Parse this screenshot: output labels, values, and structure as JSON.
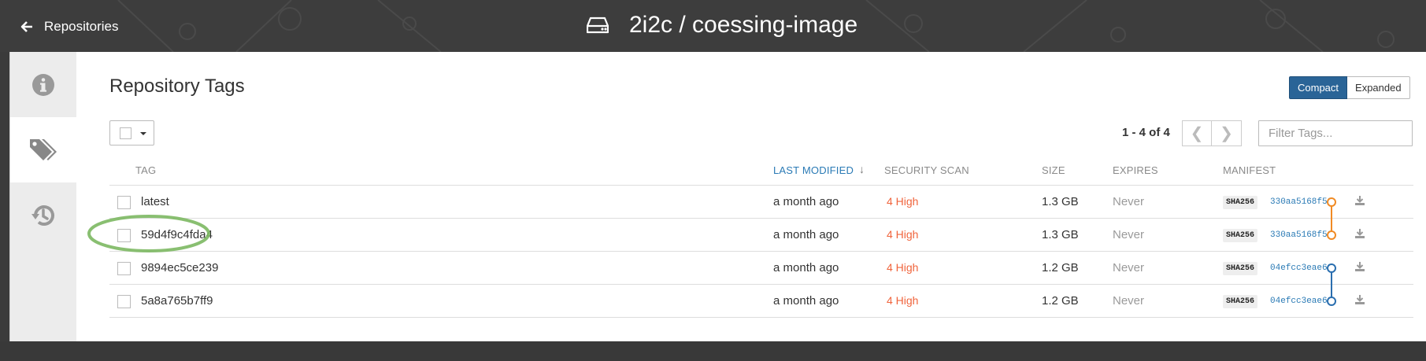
{
  "header": {
    "back_label": "Repositories",
    "repo_title": "2i2c / coessing-image"
  },
  "sidebar": {
    "items": [
      {
        "name": "info-icon",
        "active": false
      },
      {
        "name": "tags-icon",
        "active": true
      },
      {
        "name": "history-icon",
        "active": false
      }
    ]
  },
  "tags_view": {
    "title": "Repository Tags",
    "view_modes": [
      "Compact",
      "Expanded"
    ],
    "active_view": "Compact",
    "page_count": "1 - 4 of 4",
    "filter_placeholder": "Filter Tags...",
    "columns": {
      "tag": "TAG",
      "last_modified": "LAST MODIFIED",
      "security_scan": "SECURITY SCAN",
      "size": "SIZE",
      "expires": "EXPIRES",
      "manifest": "MANIFEST"
    },
    "sorted_by": "LAST MODIFIED",
    "rows": [
      {
        "tag": "latest",
        "modified": "a month ago",
        "security": "4 High",
        "size": "1.3 GB",
        "expires": "Never",
        "digest_label": "SHA256",
        "digest": "330aa5168f50"
      },
      {
        "tag": "59d4f9c4fda4",
        "modified": "a month ago",
        "security": "4 High",
        "size": "1.3 GB",
        "expires": "Never",
        "digest_label": "SHA256",
        "digest": "330aa5168f50"
      },
      {
        "tag": "9894ec5ce239",
        "modified": "a month ago",
        "security": "4 High",
        "size": "1.2 GB",
        "expires": "Never",
        "digest_label": "SHA256",
        "digest": "04efcc3eae60"
      },
      {
        "tag": "5a8a765b7ff9",
        "modified": "a month ago",
        "security": "4 High",
        "size": "1.2 GB",
        "expires": "Never",
        "digest_label": "SHA256",
        "digest": "04efcc3eae60"
      }
    ]
  },
  "colors": {
    "accent": "#2a6497",
    "security_high": "#f0643c",
    "manifest_link_a": "#f08a24",
    "manifest_link_b": "#2a6eaf",
    "highlight": "#7cb862"
  }
}
